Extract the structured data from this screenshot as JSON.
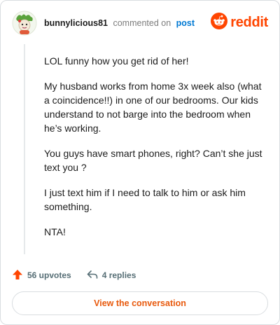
{
  "header": {
    "username": "bunnylicious81",
    "action_text": "commented on",
    "post_link": "post",
    "brand_name": "reddit"
  },
  "comment": {
    "paragraphs": [
      "LOL funny how you get rid of her!",
      "My husband works from home 3x week also (what a coincidence!!) in one of our bedrooms. Our kids understand to not barge into the bedroom when he’s working.",
      "You guys have smart phones, right? Can’t she just text you ?",
      "I just text him if I need to talk to him or ask him something.",
      "NTA!"
    ]
  },
  "actions": {
    "upvotes_label": "56 upvotes",
    "replies_label": "4 replies"
  },
  "footer": {
    "view_button_label": "View the conversation"
  },
  "colors": {
    "brand": "#ff4500",
    "link": "#0079d3",
    "cta": "#e8590c"
  },
  "icons": {
    "avatar": "avatar-icon",
    "brand": "reddit-logo-icon",
    "upvote": "upvote-arrow-icon",
    "reply": "reply-arrow-icon"
  }
}
